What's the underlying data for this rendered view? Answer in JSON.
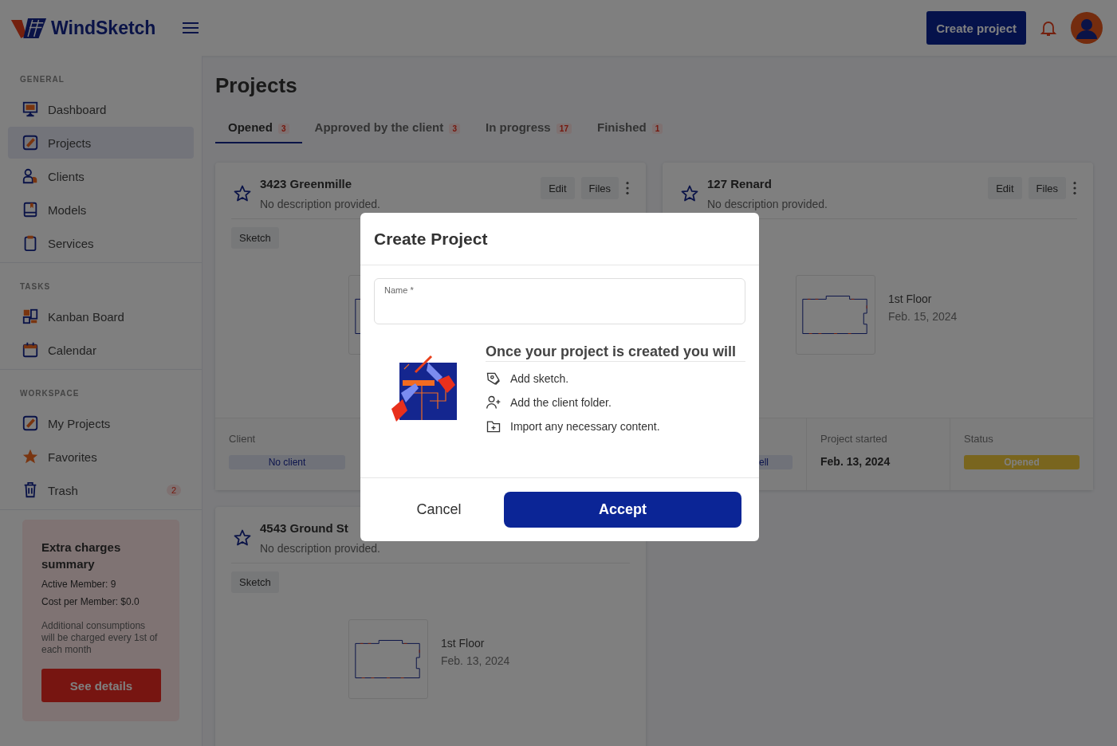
{
  "header": {
    "logo": "WindSketch",
    "create_button": "Create project"
  },
  "sidebar": {
    "sections": [
      {
        "title": "GENERAL",
        "items": [
          {
            "label": "Dashboard",
            "kind": "monitor",
            "selected": false
          },
          {
            "label": "Projects",
            "kind": "edit",
            "selected": true
          },
          {
            "label": "Clients",
            "kind": "users",
            "selected": false
          },
          {
            "label": "Models",
            "kind": "book",
            "selected": false
          },
          {
            "label": "Services",
            "kind": "clipboard",
            "selected": false
          }
        ]
      },
      {
        "title": "TASKS",
        "items": [
          {
            "label": "Kanban Board",
            "kind": "kanban",
            "selected": false
          },
          {
            "label": "Calendar",
            "kind": "calendar",
            "selected": false
          }
        ]
      },
      {
        "title": "WORKSPACE",
        "items": [
          {
            "label": "My Projects",
            "kind": "edit",
            "selected": false
          },
          {
            "label": "Favorites",
            "kind": "star",
            "selected": false
          },
          {
            "label": "Trash",
            "kind": "trash",
            "selected": false,
            "badge": "2"
          }
        ]
      }
    ],
    "promo": {
      "title": "Extra charges summary",
      "lines": [
        "Active Member: 9",
        "Cost per Member: $0.0"
      ],
      "note": "Additional consumptions will be charged every 1st of each month",
      "button": "See details"
    }
  },
  "page": {
    "title": "Projects"
  },
  "tabs": [
    {
      "label": "Opened",
      "count": "3",
      "selected": true
    },
    {
      "label": "Approved by the client",
      "count": "3",
      "selected": false
    },
    {
      "label": "In progress",
      "count": "17",
      "selected": false
    },
    {
      "label": "Finished",
      "count": "1",
      "selected": false
    }
  ],
  "cards": [
    {
      "title": "3423 Greenmille",
      "description": "No description provided.",
      "favorite": false,
      "actions": [
        "Edit",
        "Files"
      ],
      "tag": "Sketch",
      "footer": [
        {
          "kind": "pill",
          "label": "Client",
          "value": "No client"
        }
      ]
    },
    {
      "title": "127 Renard",
      "description": "No description provided.",
      "favorite": false,
      "actions": [
        "Edit",
        "Files"
      ],
      "floor": {
        "title": "1st Floor",
        "date": "Feb. 15, 2024"
      },
      "footer": [
        {
          "kind": "pill_clipped",
          "value": "ell"
        },
        {
          "kind": "text",
          "label": "Project started",
          "value": "Feb. 13, 2024"
        },
        {
          "kind": "status",
          "label": "Status",
          "value": "Opened"
        }
      ]
    },
    {
      "title": "4543 Ground St",
      "description": "No description provided.",
      "favorite": false,
      "tag": "Sketch",
      "floor": {
        "title": "1st Floor",
        "date": "Feb. 13, 2024"
      }
    }
  ],
  "dialog": {
    "title": "Create Project",
    "field_label": "Name *",
    "intro": "Once your project is created you will",
    "steps": [
      {
        "kind": "pen",
        "text": "Add sketch."
      },
      {
        "kind": "user_add",
        "text": "Add the client folder."
      },
      {
        "kind": "folder_add",
        "text": "Import any necessary content."
      }
    ],
    "cancel": "Cancel",
    "accept": "Accept"
  }
}
